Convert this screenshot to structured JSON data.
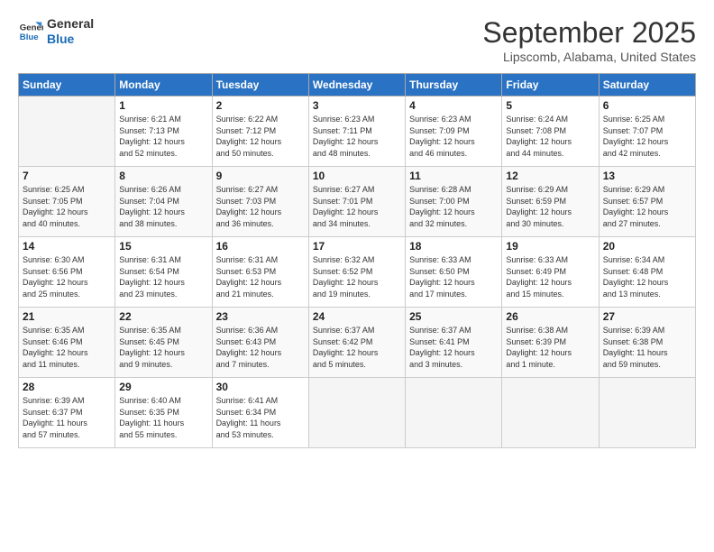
{
  "logo": {
    "line1": "General",
    "line2": "Blue"
  },
  "title": "September 2025",
  "subtitle": "Lipscomb, Alabama, United States",
  "weekdays": [
    "Sunday",
    "Monday",
    "Tuesday",
    "Wednesday",
    "Thursday",
    "Friday",
    "Saturday"
  ],
  "weeks": [
    [
      {
        "day": "",
        "info": ""
      },
      {
        "day": "1",
        "info": "Sunrise: 6:21 AM\nSunset: 7:13 PM\nDaylight: 12 hours\nand 52 minutes."
      },
      {
        "day": "2",
        "info": "Sunrise: 6:22 AM\nSunset: 7:12 PM\nDaylight: 12 hours\nand 50 minutes."
      },
      {
        "day": "3",
        "info": "Sunrise: 6:23 AM\nSunset: 7:11 PM\nDaylight: 12 hours\nand 48 minutes."
      },
      {
        "day": "4",
        "info": "Sunrise: 6:23 AM\nSunset: 7:09 PM\nDaylight: 12 hours\nand 46 minutes."
      },
      {
        "day": "5",
        "info": "Sunrise: 6:24 AM\nSunset: 7:08 PM\nDaylight: 12 hours\nand 44 minutes."
      },
      {
        "day": "6",
        "info": "Sunrise: 6:25 AM\nSunset: 7:07 PM\nDaylight: 12 hours\nand 42 minutes."
      }
    ],
    [
      {
        "day": "7",
        "info": "Sunrise: 6:25 AM\nSunset: 7:05 PM\nDaylight: 12 hours\nand 40 minutes."
      },
      {
        "day": "8",
        "info": "Sunrise: 6:26 AM\nSunset: 7:04 PM\nDaylight: 12 hours\nand 38 minutes."
      },
      {
        "day": "9",
        "info": "Sunrise: 6:27 AM\nSunset: 7:03 PM\nDaylight: 12 hours\nand 36 minutes."
      },
      {
        "day": "10",
        "info": "Sunrise: 6:27 AM\nSunset: 7:01 PM\nDaylight: 12 hours\nand 34 minutes."
      },
      {
        "day": "11",
        "info": "Sunrise: 6:28 AM\nSunset: 7:00 PM\nDaylight: 12 hours\nand 32 minutes."
      },
      {
        "day": "12",
        "info": "Sunrise: 6:29 AM\nSunset: 6:59 PM\nDaylight: 12 hours\nand 30 minutes."
      },
      {
        "day": "13",
        "info": "Sunrise: 6:29 AM\nSunset: 6:57 PM\nDaylight: 12 hours\nand 27 minutes."
      }
    ],
    [
      {
        "day": "14",
        "info": "Sunrise: 6:30 AM\nSunset: 6:56 PM\nDaylight: 12 hours\nand 25 minutes."
      },
      {
        "day": "15",
        "info": "Sunrise: 6:31 AM\nSunset: 6:54 PM\nDaylight: 12 hours\nand 23 minutes."
      },
      {
        "day": "16",
        "info": "Sunrise: 6:31 AM\nSunset: 6:53 PM\nDaylight: 12 hours\nand 21 minutes."
      },
      {
        "day": "17",
        "info": "Sunrise: 6:32 AM\nSunset: 6:52 PM\nDaylight: 12 hours\nand 19 minutes."
      },
      {
        "day": "18",
        "info": "Sunrise: 6:33 AM\nSunset: 6:50 PM\nDaylight: 12 hours\nand 17 minutes."
      },
      {
        "day": "19",
        "info": "Sunrise: 6:33 AM\nSunset: 6:49 PM\nDaylight: 12 hours\nand 15 minutes."
      },
      {
        "day": "20",
        "info": "Sunrise: 6:34 AM\nSunset: 6:48 PM\nDaylight: 12 hours\nand 13 minutes."
      }
    ],
    [
      {
        "day": "21",
        "info": "Sunrise: 6:35 AM\nSunset: 6:46 PM\nDaylight: 12 hours\nand 11 minutes."
      },
      {
        "day": "22",
        "info": "Sunrise: 6:35 AM\nSunset: 6:45 PM\nDaylight: 12 hours\nand 9 minutes."
      },
      {
        "day": "23",
        "info": "Sunrise: 6:36 AM\nSunset: 6:43 PM\nDaylight: 12 hours\nand 7 minutes."
      },
      {
        "day": "24",
        "info": "Sunrise: 6:37 AM\nSunset: 6:42 PM\nDaylight: 12 hours\nand 5 minutes."
      },
      {
        "day": "25",
        "info": "Sunrise: 6:37 AM\nSunset: 6:41 PM\nDaylight: 12 hours\nand 3 minutes."
      },
      {
        "day": "26",
        "info": "Sunrise: 6:38 AM\nSunset: 6:39 PM\nDaylight: 12 hours\nand 1 minute."
      },
      {
        "day": "27",
        "info": "Sunrise: 6:39 AM\nSunset: 6:38 PM\nDaylight: 11 hours\nand 59 minutes."
      }
    ],
    [
      {
        "day": "28",
        "info": "Sunrise: 6:39 AM\nSunset: 6:37 PM\nDaylight: 11 hours\nand 57 minutes."
      },
      {
        "day": "29",
        "info": "Sunrise: 6:40 AM\nSunset: 6:35 PM\nDaylight: 11 hours\nand 55 minutes."
      },
      {
        "day": "30",
        "info": "Sunrise: 6:41 AM\nSunset: 6:34 PM\nDaylight: 11 hours\nand 53 minutes."
      },
      {
        "day": "",
        "info": ""
      },
      {
        "day": "",
        "info": ""
      },
      {
        "day": "",
        "info": ""
      },
      {
        "day": "",
        "info": ""
      }
    ]
  ]
}
